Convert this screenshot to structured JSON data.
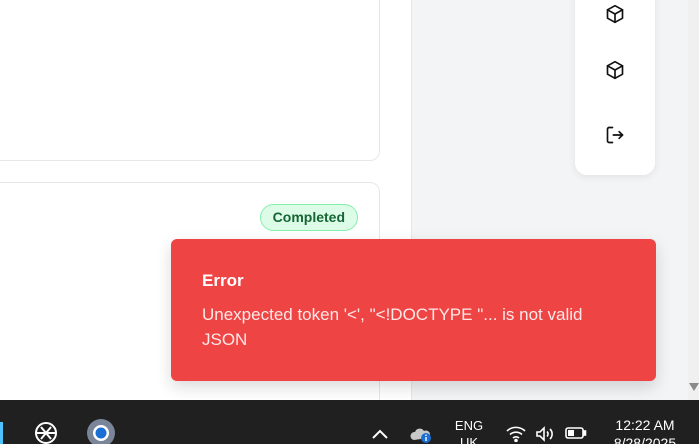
{
  "main": {
    "status_badge": "Completed"
  },
  "side_panel": {
    "items": [
      {
        "icon": "cube-icon"
      },
      {
        "icon": "cube-icon"
      },
      {
        "icon": "logout-icon"
      }
    ]
  },
  "toast": {
    "title": "Error",
    "message": "Unexpected token '<', \"<!DOCTYPE \"... is not valid JSON",
    "color": "#ef4444"
  },
  "taskbar": {
    "apps": [
      {
        "icon": "chatgpt-icon"
      },
      {
        "icon": "chrome-canary-icon"
      }
    ],
    "language": "ENG",
    "region": "UK",
    "time": "12:22 AM",
    "date": "8/28/2025"
  }
}
